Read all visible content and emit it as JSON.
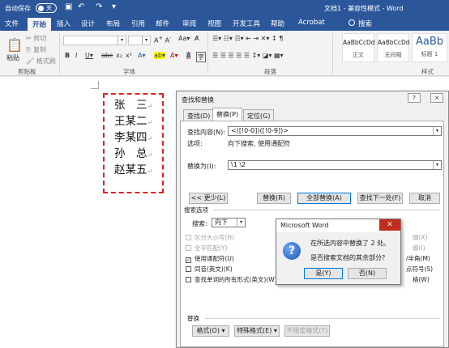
{
  "titlebar": {
    "autosave_label": "自动保存",
    "autosave_state": "关",
    "document_title": "文档1 - 兼容性模式 - Word"
  },
  "tabs": [
    {
      "label": "文件"
    },
    {
      "label": "开始"
    },
    {
      "label": "插入"
    },
    {
      "label": "设计"
    },
    {
      "label": "布局"
    },
    {
      "label": "引用"
    },
    {
      "label": "邮件"
    },
    {
      "label": "审阅"
    },
    {
      "label": "视图"
    },
    {
      "label": "开发工具"
    },
    {
      "label": "帮助"
    },
    {
      "label": "Acrobat"
    }
  ],
  "search_label": "搜索",
  "ribbon": {
    "paste": "粘贴",
    "cut": "剪切",
    "copy": "复制",
    "format_painter": "格式刷",
    "clipboard_group": "剪贴板",
    "font_group": "字体",
    "paragraph_group": "段落",
    "styles_group": "样式",
    "styles": [
      {
        "preview": "AaBbCcDd",
        "name": "正文"
      },
      {
        "preview": "AaBbCcDd",
        "name": "无间隔"
      },
      {
        "preview": "AaBb",
        "name": "标题 1"
      }
    ]
  },
  "document": {
    "lines": [
      "张　三",
      "王某二",
      "李某四",
      "孙　总",
      "赵某五"
    ]
  },
  "find_replace": {
    "title": "查找和替换",
    "help": "?",
    "close": "×",
    "tabs": [
      "查找(D)",
      "替换(P)",
      "定位(G)"
    ],
    "find_label": "查找内容(N):",
    "find_value": "<([!0-0])([!0-9])>",
    "options_label": "选项:",
    "options_value": "向下搜索, 使用通配符",
    "replace_label": "替换为(I):",
    "replace_value": "\\1 \\2",
    "buttons": {
      "less": "<< 更少(L)",
      "replace": "替换(R)",
      "replace_all": "全部替换(A)",
      "find_next": "查找下一处(F)",
      "cancel": "取消"
    },
    "search_options_title": "搜索选项",
    "search_label": "搜索:",
    "search_direction": "向下",
    "checkboxes": [
      {
        "label": "区分大小写(H)",
        "checked": false,
        "disabled": true
      },
      {
        "label": "全字匹配(Y)",
        "checked": false,
        "disabled": true
      },
      {
        "label": "使用通配符(U)",
        "checked": true,
        "disabled": false
      },
      {
        "label": "同音(英文)(K)",
        "checked": false,
        "disabled": false
      },
      {
        "label": "查找单词的所有形式(英文)(W)",
        "checked": false,
        "disabled": false
      }
    ],
    "right_fragments": [
      "缀(X)",
      "缀(I)",
      "/半角(M)",
      "点符号(S)",
      "格(W)"
    ],
    "replace_section": "替换",
    "format_btn": "格式(O) ▾",
    "special_btn": "特殊格式(E) ▾",
    "noformat_btn": "不限定格式(T)"
  },
  "message": {
    "title": "Microsoft Word",
    "close": "✕",
    "line1": "在所选内容中替换了 2 处。",
    "line2": "是否搜索文档的其余部分?",
    "yes": "是(Y)",
    "no": "否(N)"
  },
  "colors": {
    "accent": "#2b579a",
    "dashed_border": "#e02020"
  }
}
